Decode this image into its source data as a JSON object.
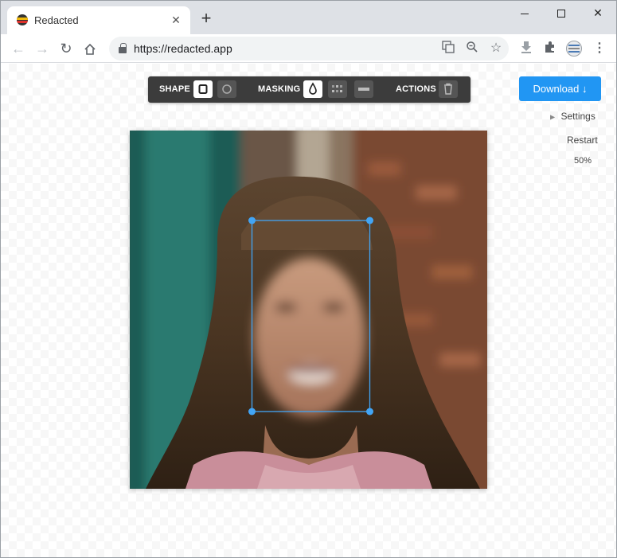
{
  "browser": {
    "tab_title": "Redacted",
    "url": "https://redacted.app"
  },
  "editor": {
    "shape_label": "SHAPE",
    "masking_label": "MASKING",
    "actions_label": "ACTIONS"
  },
  "sidebar": {
    "download_label": "Download ↓",
    "settings_label": "Settings",
    "restart_label": "Restart",
    "zoom_label": "50%"
  },
  "colors": {
    "accent": "#2196f3",
    "selection": "#42a5f5",
    "toolbar_bg": "#3c3c3c"
  }
}
